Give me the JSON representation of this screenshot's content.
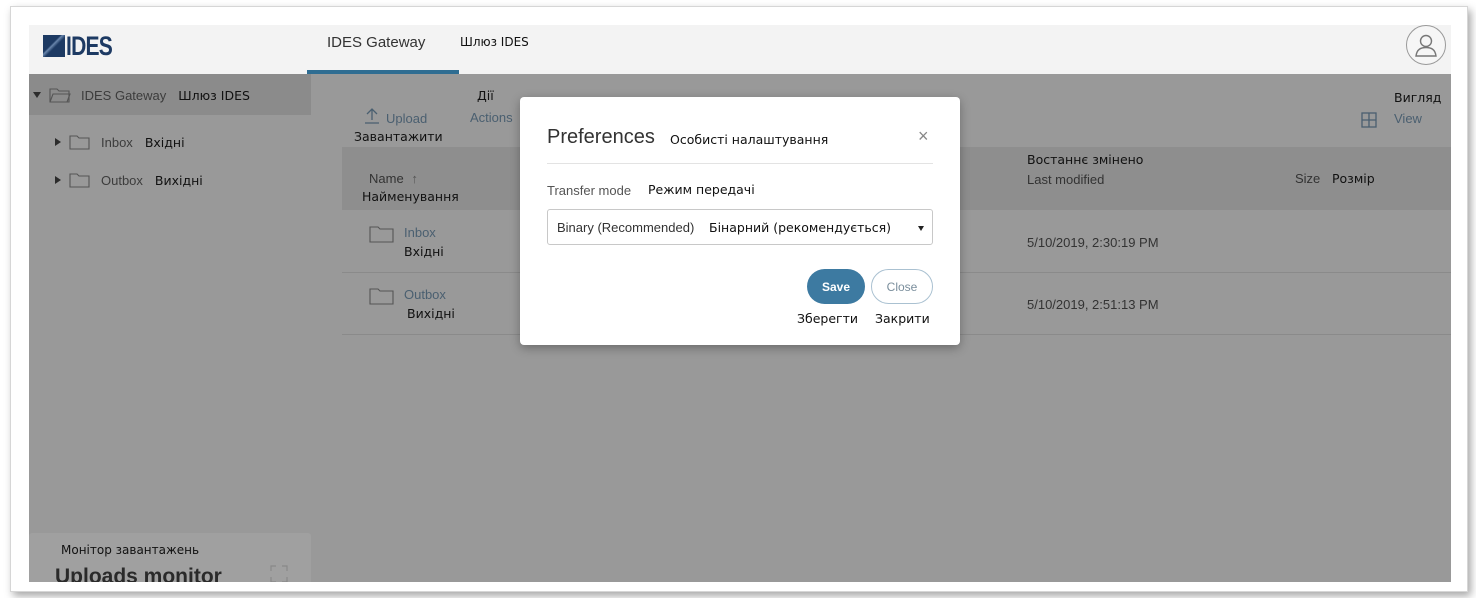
{
  "header": {
    "logo_text": "IDES",
    "tab_label": "IDES Gateway",
    "tab_label_ua": "Шлюз IDES"
  },
  "sidebar": {
    "root": {
      "label": "IDES Gateway",
      "label_ua": "Шлюз IDES"
    },
    "items": [
      {
        "label": "Inbox",
        "label_ua": "Вхідні"
      },
      {
        "label": "Outbox",
        "label_ua": "Вихідні"
      }
    ],
    "uploads_monitor": {
      "label": "Uploads monitor",
      "label_ua": "Монітор завантажень"
    }
  },
  "toolbar": {
    "upload_label": "Upload",
    "upload_label_ua": "Завантажити",
    "actions_label": "Actions",
    "actions_label_ua": "Дії",
    "view_label": "View",
    "view_label_ua": "Вигляд"
  },
  "table": {
    "columns": {
      "name": "Name",
      "name_ua": "Найменування",
      "modified": "Last modified",
      "modified_ua": "Востаннє змінено",
      "size": "Size",
      "size_ua": "Розмір"
    },
    "rows": [
      {
        "name": "Inbox",
        "name_ua": "Вхідні",
        "modified": "5/10/2019, 2:30:19 PM"
      },
      {
        "name": "Outbox",
        "name_ua": "Вихідні",
        "modified": "5/10/2019, 2:51:13 PM"
      }
    ]
  },
  "modal": {
    "title": "Preferences",
    "title_ua": "Особисті налаштування",
    "close_icon": "×",
    "field_label": "Transfer mode",
    "field_label_ua": "Режим передачі",
    "select_value": "Binary (Recommended)",
    "select_value_ua": "Бінарний (рекомендується)",
    "save_label": "Save",
    "save_label_ua": "Зберегти",
    "close_label": "Close",
    "close_label_ua": "Закрити"
  },
  "colors": {
    "accent": "#2f6d92",
    "save_button": "#3d7aa1",
    "link": "#4a5f70",
    "overlay": "#999999"
  }
}
